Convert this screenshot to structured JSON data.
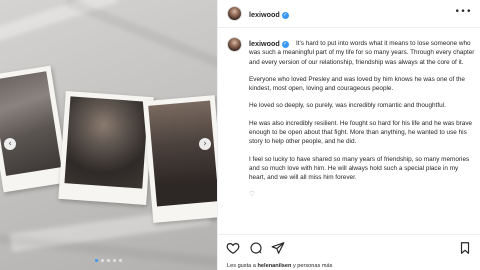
{
  "post": {
    "username": "lexiwood",
    "verified_badge": "✓",
    "more_label": "•••",
    "caption": {
      "p1": "It's hard to put into words what it means to lose someone who was such a meaningful part of my life for so many years. Through every chapter and every version of our relationship, friendship was always at the core of it.",
      "p2": "Everyone who loved Presley and was loved by him knows he was one of the kindest, most open, loving and courageous people.",
      "p3": "He loved so deeply, so purely, was incredibly romantic and thoughtful.",
      "p4": "He was also incredibly resilient. He fought so hard for his life and he was brave enough to be open about that fight. More than anything, he wanted to use his story to help other people, and he did.",
      "p5": "I feel so lucky to have shared so many years of friendship, so many memories and so much love with him. He will always hold such a special place in my heart, and we will all miss him forever.",
      "trailing_emoji": "♡"
    },
    "likes": {
      "prefix": "Les gusta a",
      "user": "helenanilsen",
      "suffix": "y personas más"
    }
  },
  "carousel": {
    "prev_label": "‹",
    "next_label": "›",
    "slide_count": 5,
    "active_slide": 1
  },
  "icons": [
    "heart-icon",
    "comment-icon",
    "share-icon",
    "save-icon",
    "more-icon",
    "verified-icon",
    "chevron-left-icon",
    "chevron-right-icon"
  ],
  "colors": {
    "verified": "#3897f0",
    "text": "#262626",
    "divider": "#efefef"
  }
}
